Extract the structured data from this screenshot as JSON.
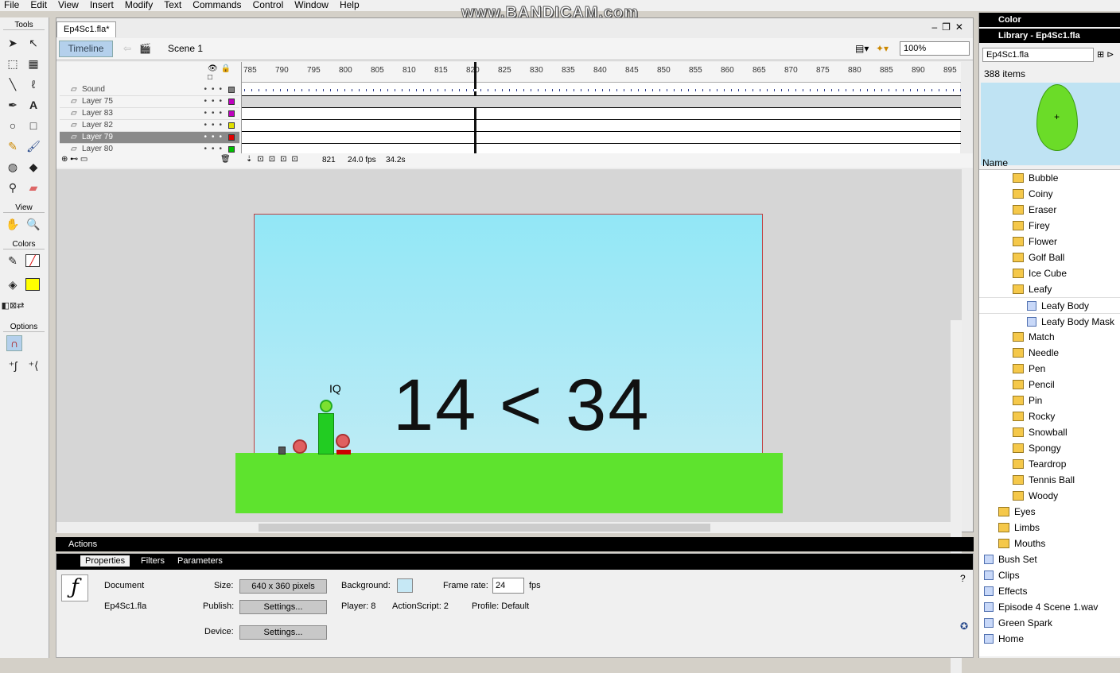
{
  "menu": [
    "File",
    "Edit",
    "View",
    "Insert",
    "Modify",
    "Text",
    "Commands",
    "Control",
    "Window",
    "Help"
  ],
  "watermark": "www.BANDICAM.com",
  "tools": {
    "header": "Tools",
    "view": "View",
    "colors": "Colors",
    "options": "Options"
  },
  "document": {
    "tab": "Ep4Sc1.fla*",
    "timeline_btn": "Timeline",
    "scene": "Scene 1",
    "zoom": "100%"
  },
  "layers": [
    "Sound",
    "Layer 75",
    "Layer 83",
    "Layer 82",
    "Layer 79",
    "Layer 80"
  ],
  "layer_colors": [
    "#808080",
    "#c000c0",
    "#c000c0",
    "#e0e000",
    "#e00000",
    "#00c000"
  ],
  "ruler": [
    "785",
    "790",
    "795",
    "800",
    "805",
    "810",
    "815",
    "820",
    "825",
    "830",
    "835",
    "840",
    "845",
    "850",
    "855",
    "860",
    "865",
    "870",
    "875",
    "880",
    "885",
    "890",
    "895"
  ],
  "status": {
    "frame": "821",
    "fps": "24.0 fps",
    "time": "34.2s"
  },
  "stage": {
    "text": "14 < 34",
    "label": "IQ"
  },
  "actions": "Actions",
  "props": {
    "tabs": [
      "Properties",
      "Filters",
      "Parameters"
    ],
    "doc_label": "Document",
    "file": "Ep4Sc1.fla",
    "size_lbl": "Size:",
    "size_val": "640 x 360 pixels",
    "bg_lbl": "Background:",
    "fr_lbl": "Frame rate:",
    "fr_val": "24",
    "fps": "fps",
    "publish_lbl": "Publish:",
    "settings": "Settings...",
    "player": "Player: 8",
    "as": "ActionScript:  2",
    "profile": "Profile:  Default",
    "device_lbl": "Device:"
  },
  "library": {
    "color_hdr": "Color",
    "lib_hdr": "Library - Ep4Sc1.fla",
    "select": "Ep4Sc1.fla",
    "count": "388 items",
    "name_col": "Name",
    "items": [
      {
        "label": "Bubble",
        "type": "folder",
        "indent": 2
      },
      {
        "label": "Coiny",
        "type": "folder",
        "indent": 2
      },
      {
        "label": "Eraser",
        "type": "folder",
        "indent": 2
      },
      {
        "label": "Firey",
        "type": "folder",
        "indent": 2
      },
      {
        "label": "Flower",
        "type": "folder",
        "indent": 2
      },
      {
        "label": "Golf Ball",
        "type": "folder",
        "indent": 2
      },
      {
        "label": "Ice Cube",
        "type": "folder",
        "indent": 2
      },
      {
        "label": "Leafy",
        "type": "folder",
        "indent": 2
      },
      {
        "label": "Leafy Body",
        "type": "sym",
        "indent": 3
      },
      {
        "label": "Leafy Body Mask",
        "type": "sym",
        "indent": 3
      },
      {
        "label": "Match",
        "type": "folder",
        "indent": 2
      },
      {
        "label": "Needle",
        "type": "folder",
        "indent": 2
      },
      {
        "label": "Pen",
        "type": "folder",
        "indent": 2
      },
      {
        "label": "Pencil",
        "type": "folder",
        "indent": 2
      },
      {
        "label": "Pin",
        "type": "folder",
        "indent": 2
      },
      {
        "label": "Rocky",
        "type": "folder",
        "indent": 2
      },
      {
        "label": "Snowball",
        "type": "folder",
        "indent": 2
      },
      {
        "label": "Spongy",
        "type": "folder",
        "indent": 2
      },
      {
        "label": "Teardrop",
        "type": "folder",
        "indent": 2
      },
      {
        "label": "Tennis Ball",
        "type": "folder",
        "indent": 2
      },
      {
        "label": "Woody",
        "type": "folder",
        "indent": 2
      },
      {
        "label": "Eyes",
        "type": "folder",
        "indent": 1
      },
      {
        "label": "Limbs",
        "type": "folder",
        "indent": 1
      },
      {
        "label": "Mouths",
        "type": "folder",
        "indent": 1
      },
      {
        "label": "Bush Set",
        "type": "sym",
        "indent": 0
      },
      {
        "label": "Clips",
        "type": "sym",
        "indent": 0
      },
      {
        "label": "Effects",
        "type": "sym",
        "indent": 0
      },
      {
        "label": "Episode 4 Scene 1.wav",
        "type": "sym",
        "indent": 0
      },
      {
        "label": "Green Spark",
        "type": "sym",
        "indent": 0
      },
      {
        "label": "Home",
        "type": "sym",
        "indent": 0
      }
    ]
  }
}
